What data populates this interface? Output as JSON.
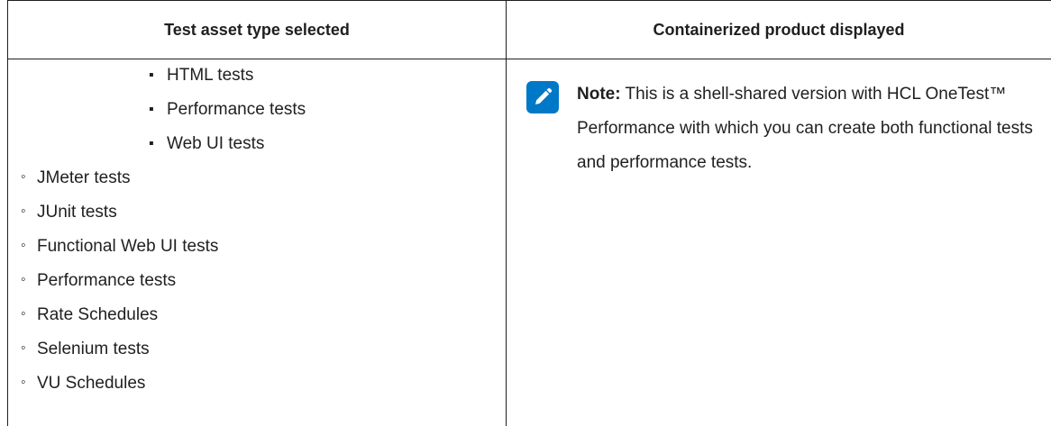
{
  "table": {
    "headers": [
      "Test asset type selected",
      "Containerized product displayed"
    ],
    "nested_items": [
      "HTML tests",
      "Performance tests",
      "Web UI tests"
    ],
    "nested_bullet": "▪",
    "outer_items": [
      "JMeter tests",
      "JUnit tests",
      "Functional Web UI tests",
      "Performance tests",
      "Rate Schedules",
      "Selenium tests",
      "VU Schedules"
    ],
    "outer_bullet": "◦",
    "note": {
      "label": "Note:",
      "text": "This is a shell-shared version with HCL OneTest™ Performance with which you can create both functional tests and performance tests.",
      "icon": "pencil-icon",
      "icon_color": "#0078c8"
    }
  }
}
